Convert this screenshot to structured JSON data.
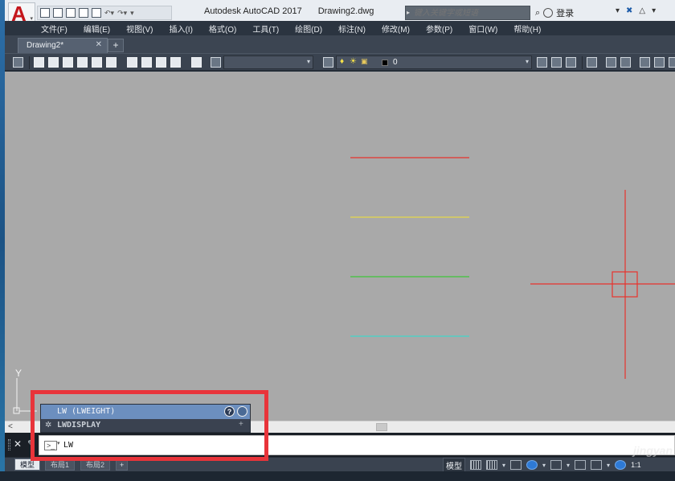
{
  "window": {
    "app_title": "Autodesk AutoCAD 2017",
    "doc_title": "Drawing2.dwg",
    "search_placeholder": "键入关键字或短语",
    "signin_label": "登录"
  },
  "menubar": {
    "items": [
      "文件(F)",
      "编辑(E)",
      "视图(V)",
      "插入(I)",
      "格式(O)",
      "工具(T)",
      "绘图(D)",
      "标注(N)",
      "修改(M)",
      "参数(P)",
      "窗口(W)",
      "帮助(H)"
    ]
  },
  "file_tabs": {
    "active_tab": "Drawing2*",
    "close_glyph": "✕",
    "new_tab_glyph": "+"
  },
  "toolbar": {
    "layer_value": "0"
  },
  "canvas": {
    "background": "#a9a9a9",
    "line_colors": [
      "#e8322d",
      "#e6d84a",
      "#3fc63a",
      "#41d6c9"
    ],
    "crosshair_color": "#e8322d",
    "ucs_y_label": "Y"
  },
  "autocomplete": {
    "item1": "LW (LWEIGHT)",
    "item2": "LWDISPLAY",
    "item2_plus": "+"
  },
  "command_line": {
    "input_value": "LW",
    "prompt_glyph": ">_"
  },
  "status": {
    "layout_tabs": [
      "模型",
      "布局1",
      "布局2"
    ],
    "add_tab": "+",
    "model_label": "模型",
    "scale": "1:1"
  },
  "watermark": "jingyan",
  "highlight_color": "#e8343a"
}
